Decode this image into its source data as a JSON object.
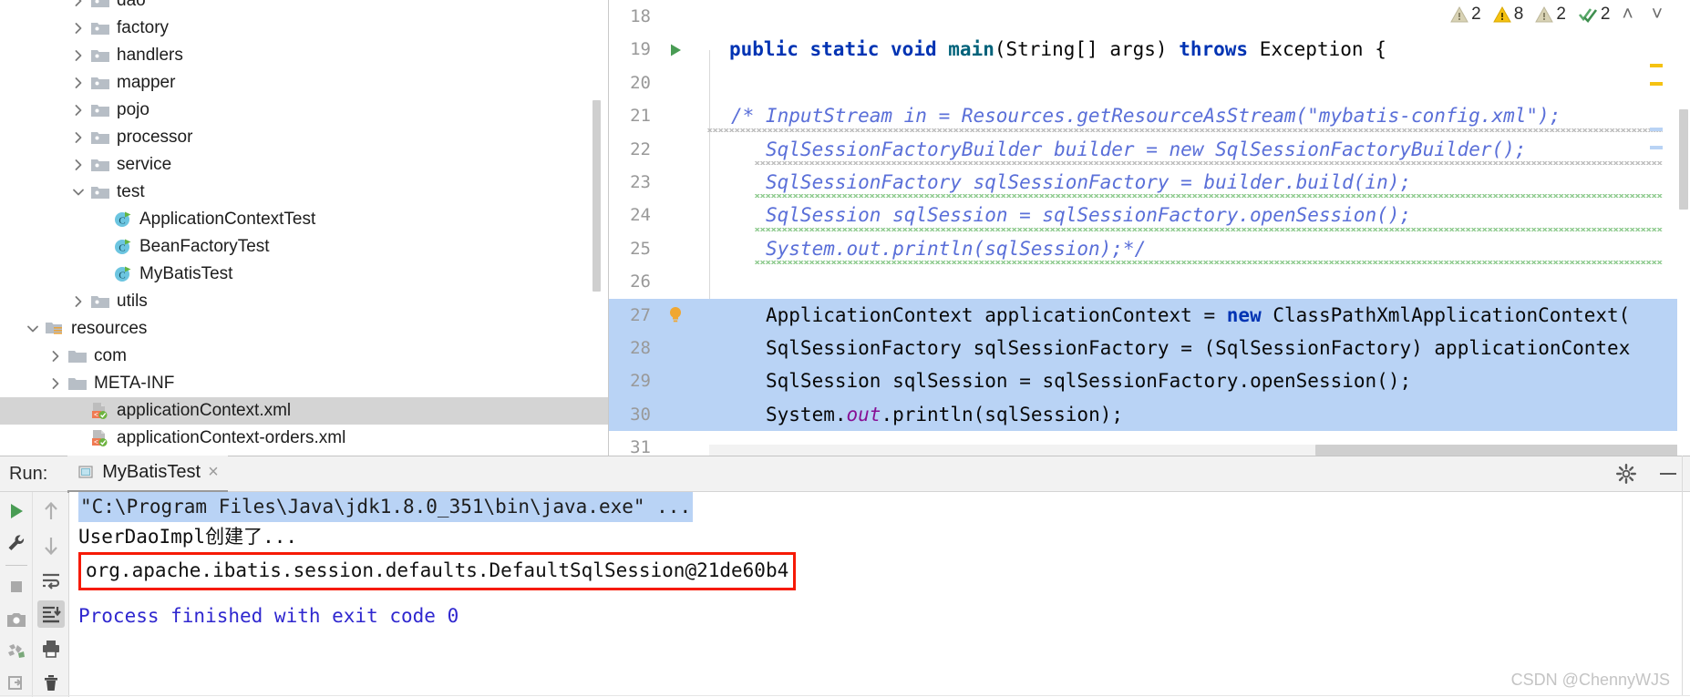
{
  "project_tree": {
    "rows": [
      {
        "label": "dao",
        "indent": 3,
        "arrow": "right",
        "icon": "package-folder",
        "selected": false,
        "clipped_top": true
      },
      {
        "label": "factory",
        "indent": 3,
        "arrow": "right",
        "icon": "package-folder",
        "selected": false
      },
      {
        "label": "handlers",
        "indent": 3,
        "arrow": "right",
        "icon": "package-folder",
        "selected": false
      },
      {
        "label": "mapper",
        "indent": 3,
        "arrow": "right",
        "icon": "package-folder",
        "selected": false
      },
      {
        "label": "pojo",
        "indent": 3,
        "arrow": "right",
        "icon": "package-folder",
        "selected": false
      },
      {
        "label": "processor",
        "indent": 3,
        "arrow": "right",
        "icon": "package-folder",
        "selected": false
      },
      {
        "label": "service",
        "indent": 3,
        "arrow": "right",
        "icon": "package-folder",
        "selected": false
      },
      {
        "label": "test",
        "indent": 3,
        "arrow": "down",
        "icon": "package-folder",
        "selected": false
      },
      {
        "label": "ApplicationContextTest",
        "indent": 4,
        "arrow": "none",
        "icon": "java-class-runnable",
        "selected": false
      },
      {
        "label": "BeanFactoryTest",
        "indent": 4,
        "arrow": "none",
        "icon": "java-class-runnable",
        "selected": false
      },
      {
        "label": "MyBatisTest",
        "indent": 4,
        "arrow": "none",
        "icon": "java-class-runnable",
        "selected": false
      },
      {
        "label": "utils",
        "indent": 3,
        "arrow": "right",
        "icon": "package-folder",
        "selected": false
      },
      {
        "label": "resources",
        "indent": 1,
        "arrow": "down",
        "icon": "resources-folder",
        "selected": false
      },
      {
        "label": "com",
        "indent": 2,
        "arrow": "right",
        "icon": "plain-folder",
        "selected": false
      },
      {
        "label": "META-INF",
        "indent": 2,
        "arrow": "right",
        "icon": "plain-folder",
        "selected": false
      },
      {
        "label": "applicationContext.xml",
        "indent": 3,
        "arrow": "none",
        "icon": "spring-xml",
        "selected": true
      },
      {
        "label": "applicationContext-orders.xml",
        "indent": 3,
        "arrow": "none",
        "icon": "spring-xml",
        "selected": false
      }
    ]
  },
  "editor": {
    "inspections": [
      {
        "icon": "warning-weak-icon",
        "count": "2",
        "color": "#d6cfa8"
      },
      {
        "icon": "warning-icon",
        "count": "8",
        "color": "#f5c211"
      },
      {
        "icon": "warning-weak-icon",
        "count": "2",
        "color": "#d6cfa8"
      },
      {
        "icon": "check-double-icon",
        "count": "2",
        "color": "#59a869"
      }
    ],
    "nav_up": "˄",
    "nav_down": "˅",
    "lines": [
      {
        "num": "18",
        "text": "",
        "gutter": "none",
        "highlight": false
      },
      {
        "num": "19",
        "text": "public static void main(String[] args) throws Exception {",
        "gutter": "run-gutter-icon",
        "highlight": false
      },
      {
        "num": "20",
        "text": "",
        "gutter": "none",
        "highlight": false
      },
      {
        "num": "21",
        "text": "/* InputStream in = Resources.getResourceAsStream(\"mybatis-config.xml\");",
        "gutter": "none",
        "highlight": false
      },
      {
        "num": "22",
        "text": "SqlSessionFactoryBuilder builder = new SqlSessionFactoryBuilder();",
        "gutter": "none",
        "highlight": false
      },
      {
        "num": "23",
        "text": "SqlSessionFactory sqlSessionFactory = builder.build(in);",
        "gutter": "none",
        "highlight": false
      },
      {
        "num": "24",
        "text": "SqlSession sqlSession = sqlSessionFactory.openSession();",
        "gutter": "none",
        "highlight": false
      },
      {
        "num": "25",
        "text": "System.out.println(sqlSession);*/",
        "gutter": "none",
        "highlight": false
      },
      {
        "num": "26",
        "text": "",
        "gutter": "none",
        "highlight": false
      },
      {
        "num": "27",
        "text": "ApplicationContext applicationContext = new ClassPathXmlApplicationContext(",
        "gutter": "lightbulb-icon",
        "highlight": true
      },
      {
        "num": "28",
        "text": "SqlSessionFactory sqlSessionFactory = (SqlSessionFactory) applicationContex",
        "gutter": "none",
        "highlight": true
      },
      {
        "num": "29",
        "text": "SqlSession sqlSession = sqlSessionFactory.openSession();",
        "gutter": "none",
        "highlight": true
      },
      {
        "num": "30",
        "text": "System.out.println(sqlSession);",
        "gutter": "none",
        "highlight": true
      },
      {
        "num": "31",
        "text": "",
        "gutter": "none",
        "highlight": false
      }
    ]
  },
  "run_panel": {
    "label": "Run:",
    "tab_title": "MyBatisTest",
    "close_icon": "×",
    "settings_icon": "gear-icon",
    "minimize_icon": "minimize-icon",
    "toolbar_left": [
      {
        "icon": "rerun-play-icon",
        "active": false
      },
      {
        "icon": "wrench-settings-icon",
        "active": false
      },
      {
        "icon": "separator",
        "active": false
      },
      {
        "icon": "stop-icon",
        "active": false
      },
      {
        "icon": "camera-snapshot-icon",
        "active": false
      },
      {
        "icon": "thread-dump-icon",
        "active": false
      },
      {
        "icon": "restore-layout-icon",
        "active": false
      }
    ],
    "toolbar_right": [
      {
        "icon": "arrow-up-icon",
        "active": false
      },
      {
        "icon": "arrow-down-icon",
        "active": false
      },
      {
        "icon": "soft-wrap-icon",
        "active": false
      },
      {
        "icon": "scroll-to-end-icon",
        "active": true
      },
      {
        "icon": "print-icon",
        "active": false
      },
      {
        "icon": "trash-icon",
        "active": false
      }
    ],
    "console": {
      "command": "\"C:\\Program Files\\Java\\jdk1.8.0_351\\bin\\java.exe\" ...",
      "output_1": "UserDaoImpl创建了...",
      "highlighted_output": "org.apache.ibatis.session.defaults.DefaultSqlSession@21de60b4",
      "exit_line": "Process finished with exit code 0"
    }
  },
  "watermark": "CSDN @ChennyWJS",
  "colors": {
    "selection_blue": "#b9d3f5",
    "tree_selection": "#d4d4d4",
    "highlight_box_red": "#f61a06",
    "exit_text_purple": "#2f27cf",
    "comment_blue": "#5a6fd8",
    "keyword_blue": "#0033b3"
  }
}
